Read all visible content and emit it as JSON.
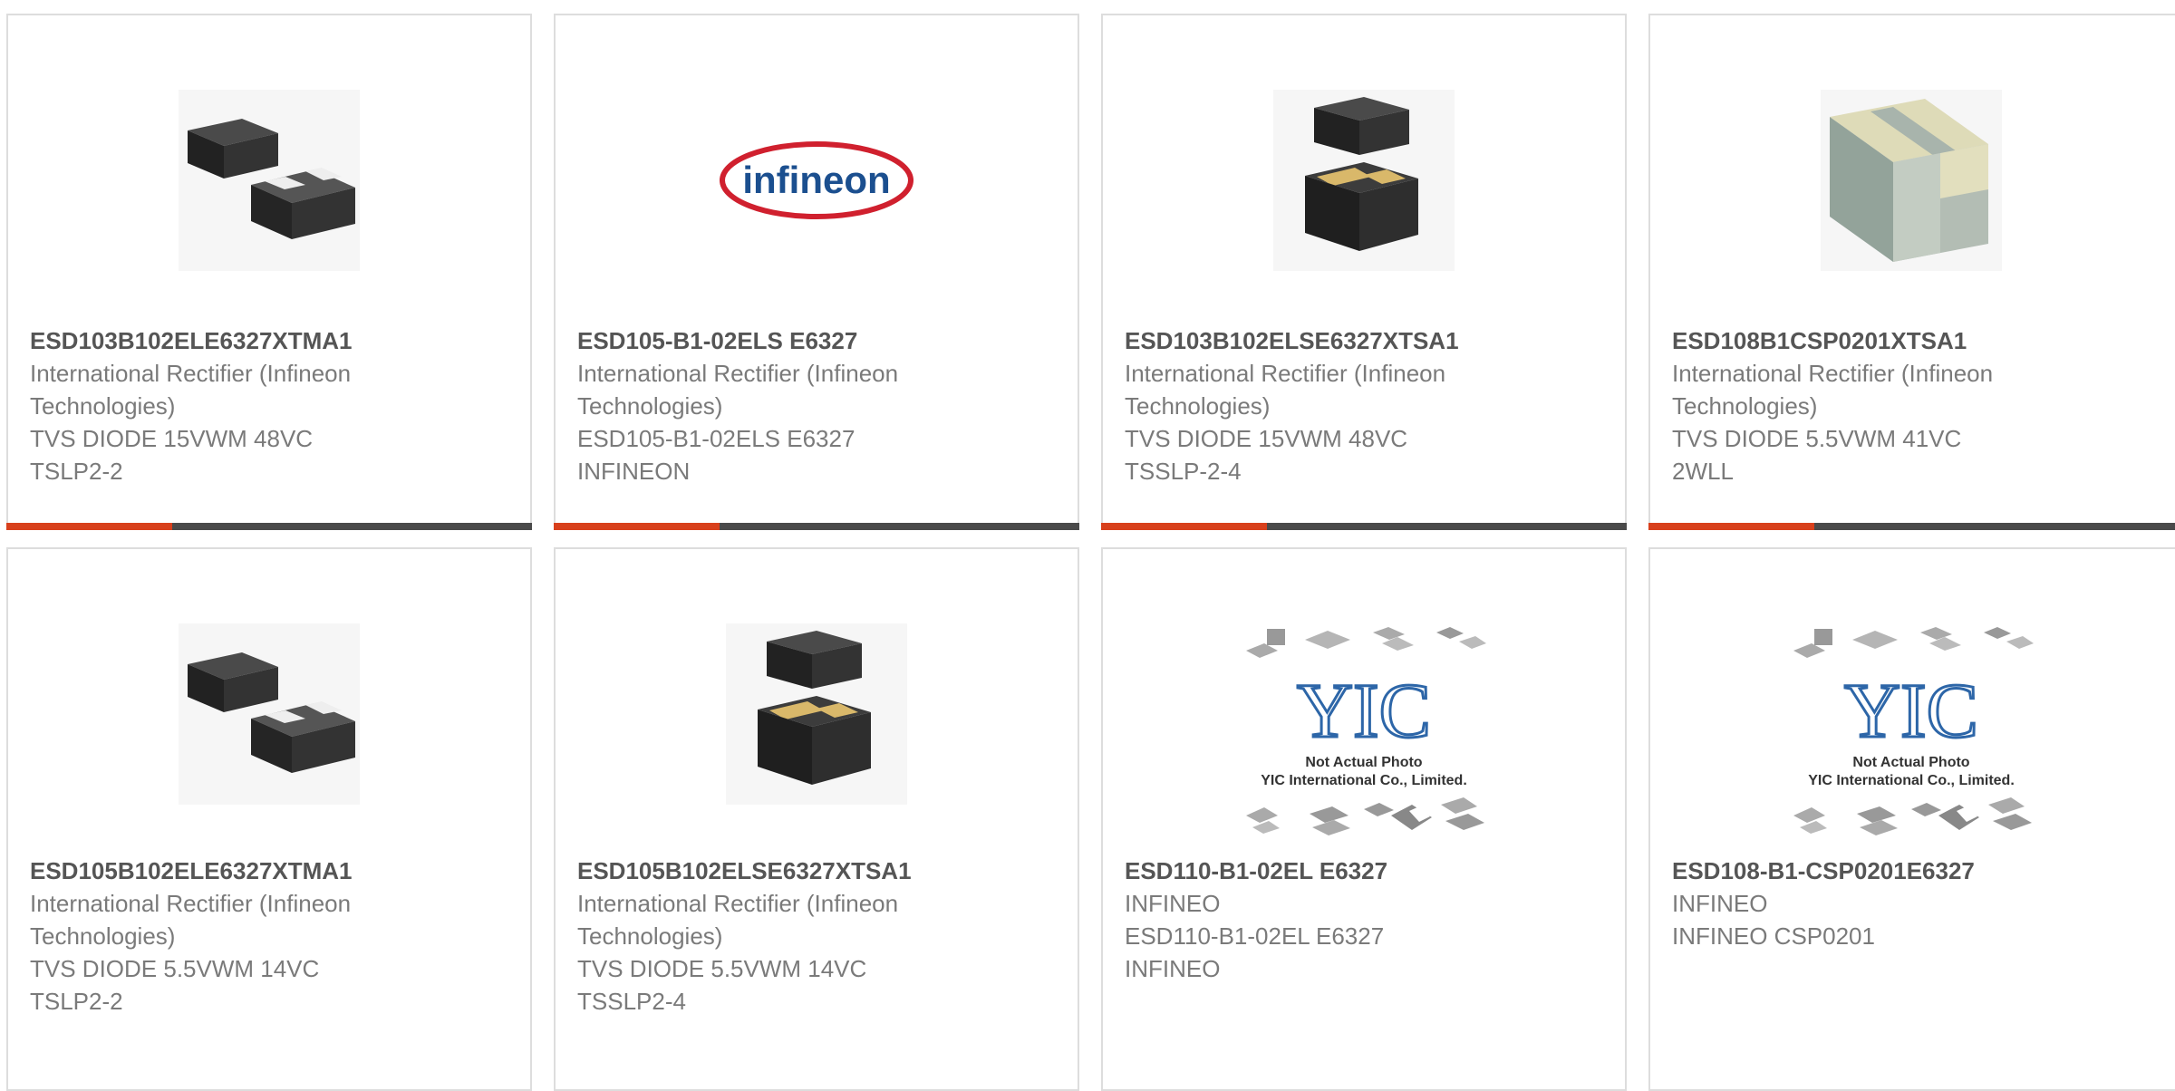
{
  "colors": {
    "accent": "#d8401c",
    "bar_dark": "#4a4a4a",
    "border": "#dddddd",
    "part_text": "#555555",
    "body_text": "#7a7a7a"
  },
  "logos": {
    "infineon": "infineon",
    "yic_watermark": "YIC",
    "yic_line1": "Not Actual Photo",
    "yic_line2": "YIC International Co., Limited."
  },
  "products": [
    {
      "part": "ESD103B102ELE6327XTMA1",
      "manufacturer": "International Rectifier (Infineon Technologies)",
      "desc": "TVS DIODE 15VWM 48VC",
      "package": "TSLP2-2",
      "image": "tslp2-2-package"
    },
    {
      "part": "ESD105-B1-02ELS E6327",
      "manufacturer": "International Rectifier (Infineon Technologies)",
      "desc": "ESD105-B1-02ELS E6327",
      "package": "INFINEON",
      "image": "infineon-logo"
    },
    {
      "part": "ESD103B102ELSE6327XTSA1",
      "manufacturer": "International Rectifier (Infineon Technologies)",
      "desc": "TVS DIODE 15VWM 48VC",
      "package": "TSSLP-2-4",
      "image": "tsslp-package"
    },
    {
      "part": "ESD108B1CSP0201XTSA1",
      "manufacturer": "International Rectifier (Infineon Technologies)",
      "desc": "TVS DIODE 5.5VWM 41VC",
      "package": "2WLL",
      "image": "wll-package"
    },
    {
      "part": "ESD105B102ELE6327XTMA1",
      "manufacturer": "International Rectifier (Infineon Technologies)",
      "desc": "TVS DIODE 5.5VWM 14VC",
      "package": "TSLP2-2",
      "image": "tslp2-2-package"
    },
    {
      "part": "ESD105B102ELSE6327XTSA1",
      "manufacturer": "International Rectifier (Infineon Technologies)",
      "desc": "TVS DIODE 5.5VWM 14VC",
      "package": "TSSLP2-4",
      "image": "tsslp-package"
    },
    {
      "part": "ESD110-B1-02EL E6327",
      "manufacturer": "INFINEO",
      "desc": "ESD110-B1-02EL E6327",
      "package": "INFINEO",
      "image": "yic-placeholder"
    },
    {
      "part": "ESD108-B1-CSP0201E6327",
      "manufacturer": "INFINEO",
      "desc": "INFINEO CSP0201",
      "package": "",
      "image": "yic-placeholder"
    }
  ]
}
